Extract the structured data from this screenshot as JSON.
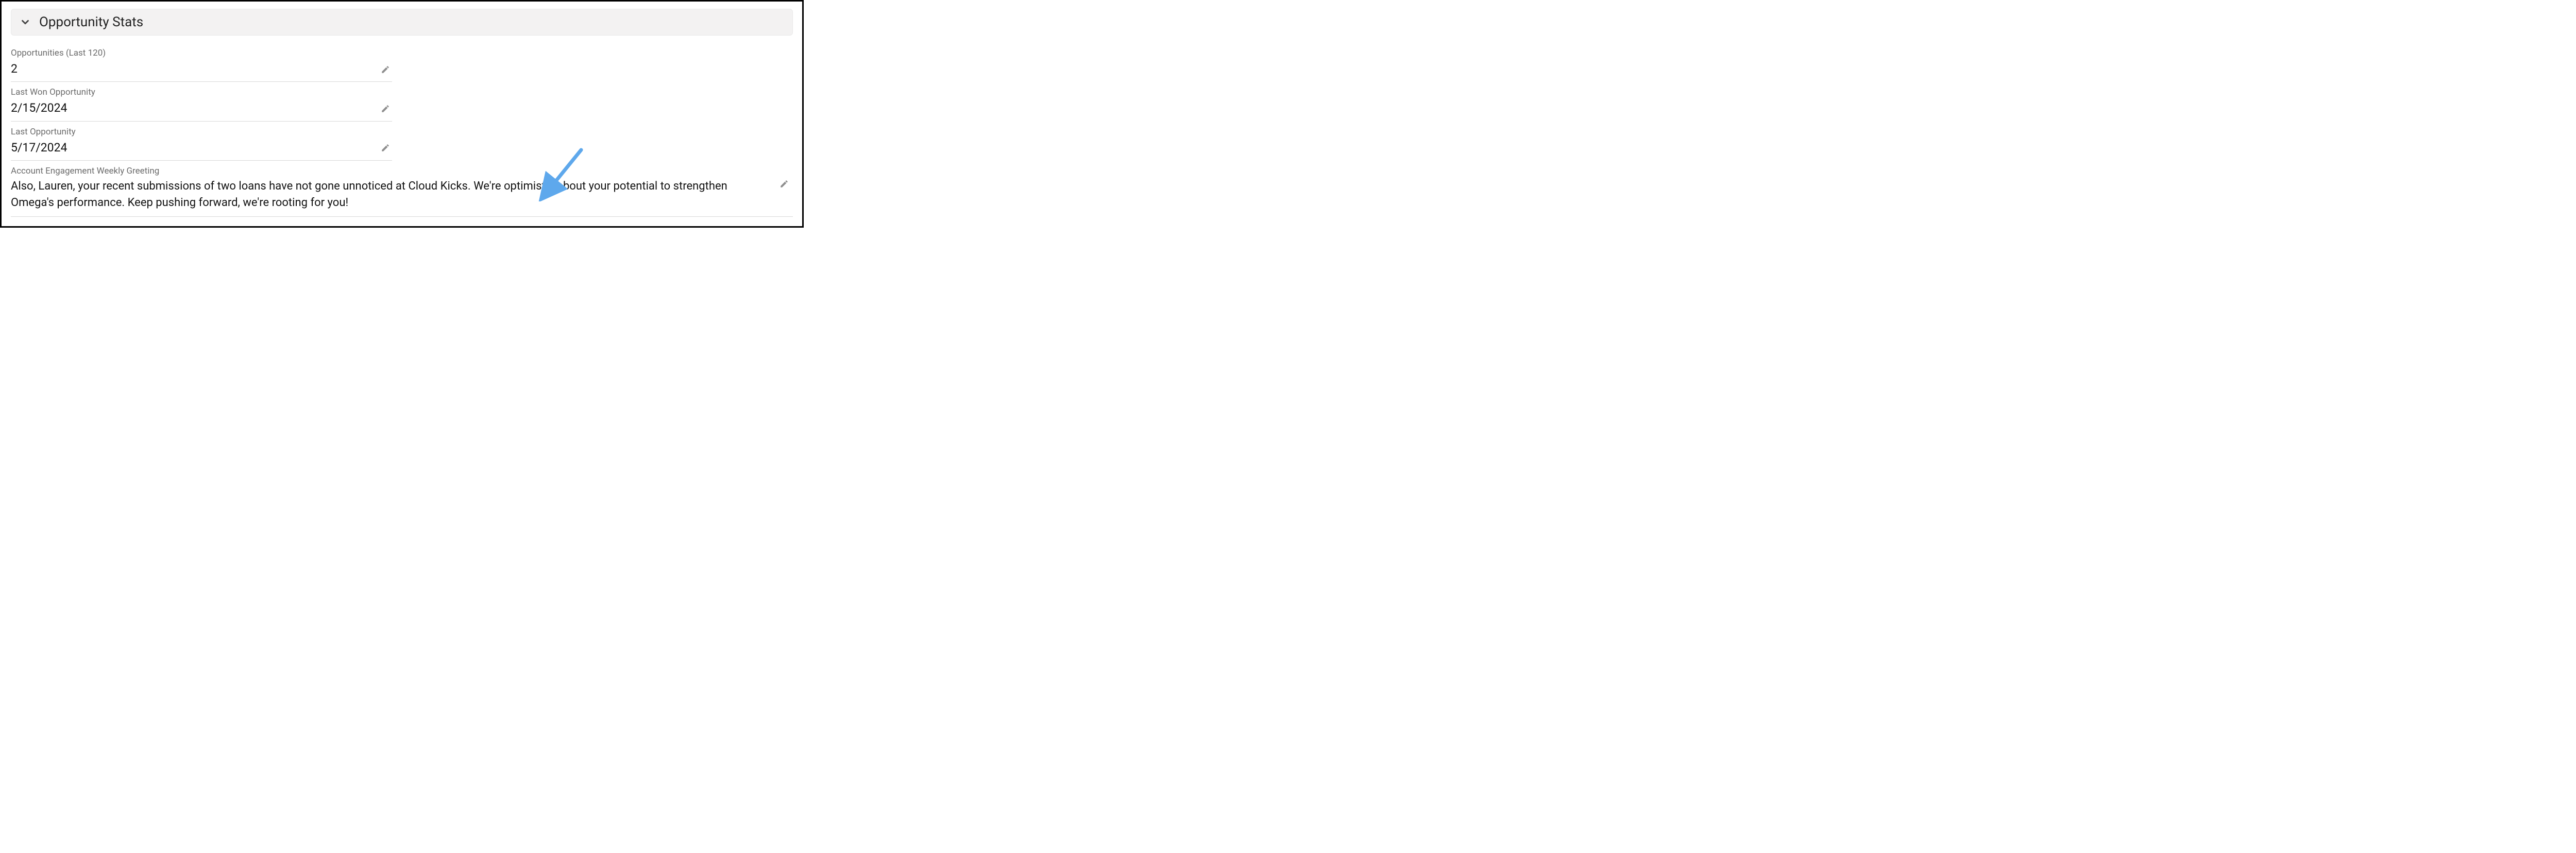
{
  "section": {
    "title": "Opportunity Stats"
  },
  "fields": {
    "opportunities_last_120": {
      "label": "Opportunities (Last 120)",
      "value": "2"
    },
    "last_won_opportunity": {
      "label": "Last Won Opportunity",
      "value": "2/15/2024"
    },
    "last_opportunity": {
      "label": "Last Opportunity",
      "value": "5/17/2024"
    },
    "weekly_greeting": {
      "label": "Account Engagement Weekly Greeting",
      "value": "Also, Lauren, your recent submissions of two loans have not gone unnoticed at Cloud Kicks. We're optimistic about your potential to strengthen Omega's performance. Keep pushing forward, we're rooting for you!"
    }
  },
  "icons": {
    "chevron": "chevron-down-icon",
    "pencil": "pencil-icon"
  },
  "annotation": {
    "arrow_color": "#5ea8ec"
  }
}
